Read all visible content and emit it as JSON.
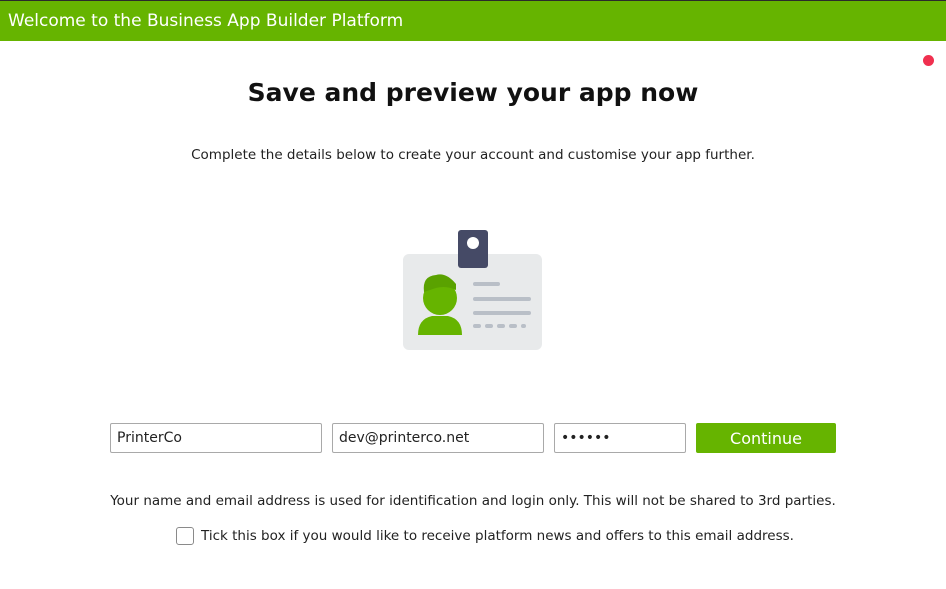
{
  "header": {
    "title": "Welcome to the Business App Builder Platform"
  },
  "main": {
    "title": "Save and preview your app now",
    "subtitle": "Complete the details below to create your account and customise your app further.",
    "illustration": {
      "icon": "id-badge-icon"
    }
  },
  "form": {
    "name_value": "PrinterCo",
    "email_value": "dev@printerco.net",
    "password_value": "secret",
    "continue_label": "Continue",
    "privacy_note": "Your name and email address is used for identification and login only. This will not be shared to 3rd parties.",
    "optin_label": "Tick this box if you would like to receive platform news and offers to this email address.",
    "optin_checked": false
  },
  "colors": {
    "brand_green": "#66b400",
    "close_dot": "#f0304f",
    "badge_clip": "#454a66",
    "card_bg": "#e8eaeb",
    "line_gray": "#b9bfc7"
  }
}
